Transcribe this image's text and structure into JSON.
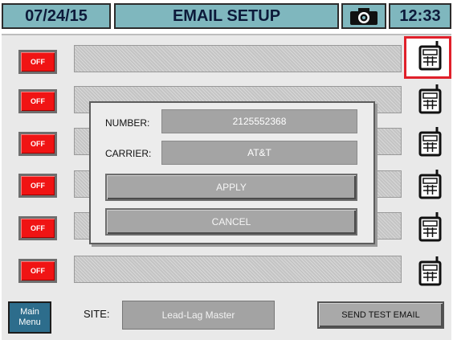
{
  "header": {
    "date": "07/24/15",
    "title": "EMAIL SETUP",
    "camera_icon": "camera-icon",
    "time": "12:33"
  },
  "rows": [
    {
      "toggle_label": "OFF",
      "phone_icon": "phone-icon",
      "highlighted": true
    },
    {
      "toggle_label": "OFF",
      "phone_icon": "phone-icon",
      "highlighted": false
    },
    {
      "toggle_label": "OFF",
      "phone_icon": "phone-icon",
      "highlighted": false
    },
    {
      "toggle_label": "OFF",
      "phone_icon": "phone-icon",
      "highlighted": false
    },
    {
      "toggle_label": "OFF",
      "phone_icon": "phone-icon",
      "highlighted": false
    },
    {
      "toggle_label": "OFF",
      "phone_icon": "phone-icon",
      "highlighted": false
    }
  ],
  "modal": {
    "number_label": "NUMBER:",
    "number_value": "2125552368",
    "carrier_label": "CARRIER:",
    "carrier_value": "AT&T",
    "apply_label": "APPLY",
    "cancel_label": "CANCEL"
  },
  "footer": {
    "main_menu_label": "Main\nMenu",
    "site_label": "SITE:",
    "site_value": "Lead-Lag Master",
    "send_test_label": "SEND TEST EMAIL"
  },
  "colors": {
    "header_bg": "#7fb7be",
    "toggle_off": "#f01414",
    "highlight": "#e0202a",
    "main_menu_bg": "#2d6d8c"
  }
}
